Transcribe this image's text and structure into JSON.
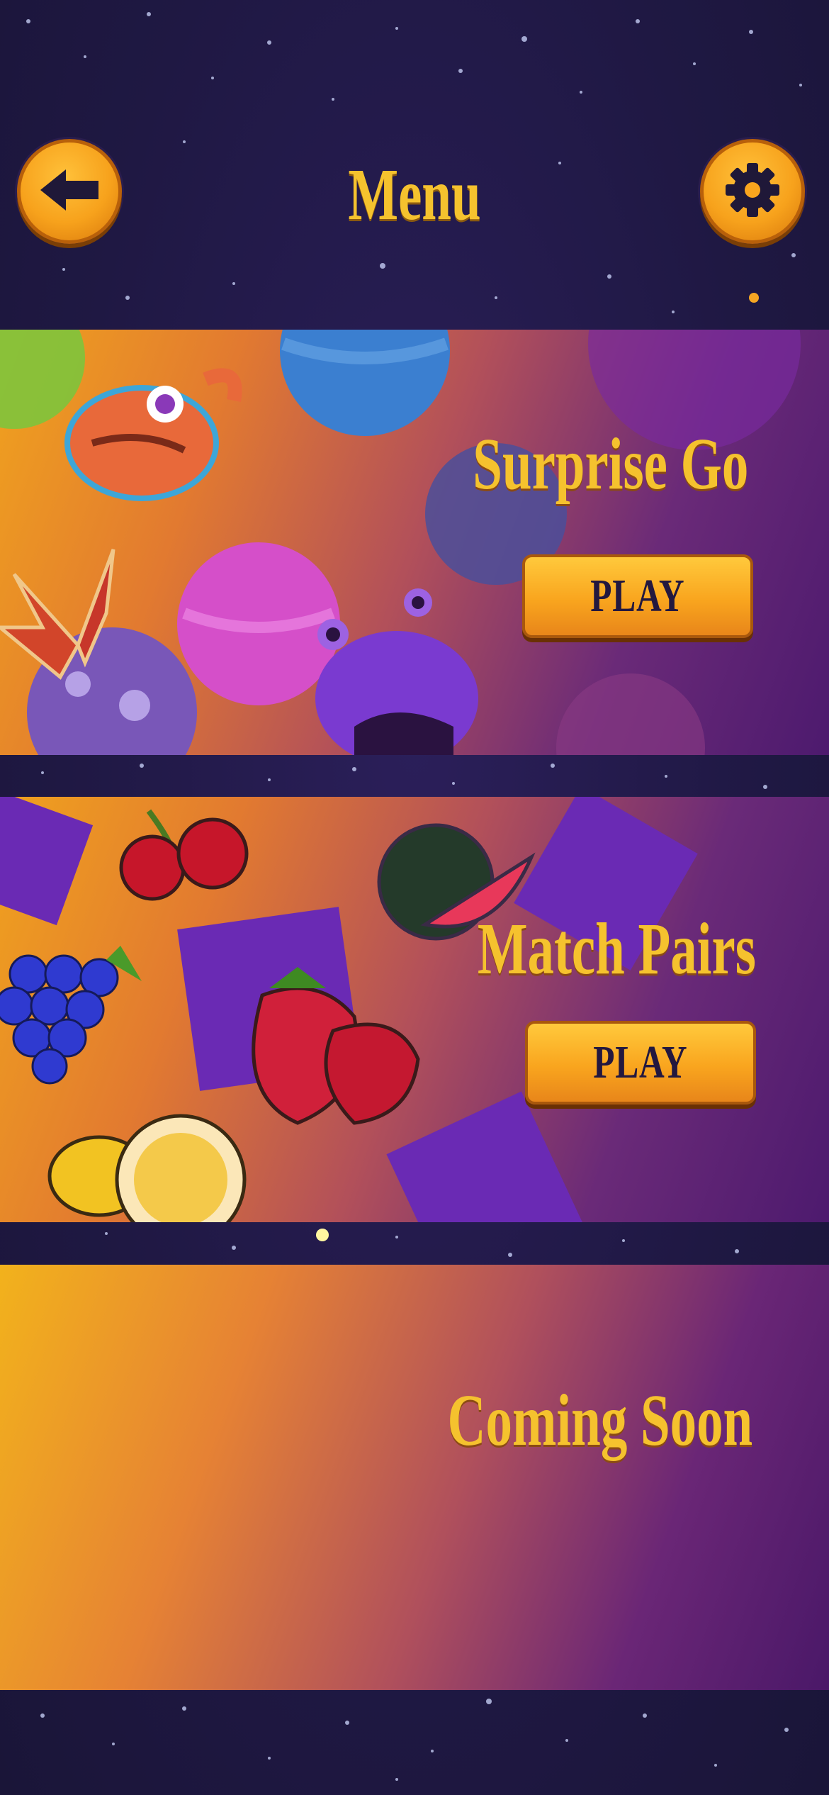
{
  "header": {
    "title": "Menu",
    "back_icon": "arrow-left-icon",
    "settings_icon": "gear-icon"
  },
  "games": [
    {
      "title": "Surprise Go",
      "play_label": "PLAY"
    },
    {
      "title": "Match Pairs",
      "play_label": "PLAY"
    },
    {
      "title": "Coming Soon"
    }
  ],
  "colors": {
    "accent_gold": "#f5c22e",
    "button_orange": "#f9a51e",
    "background_navy": "#201845",
    "panel_purple": "#4d1a6e"
  }
}
